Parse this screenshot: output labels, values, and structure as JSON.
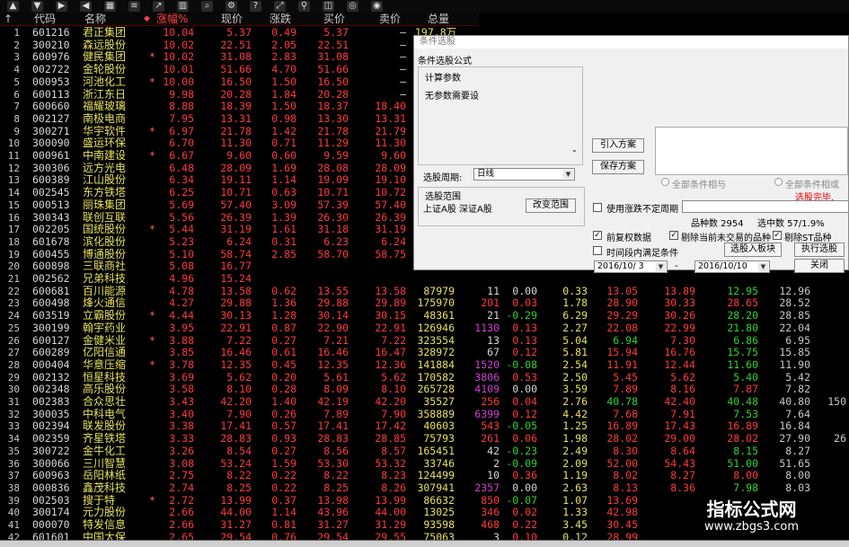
{
  "toolbar_icons": [
    "arrow-up-icon",
    "arrow-down-icon",
    "arrow-right-icon",
    "arrow-left-icon",
    "grid-icon",
    "list-icon",
    "chart-icon",
    "bars-icon",
    "search-icon",
    "settings-icon",
    "help-icon",
    "expand-icon",
    "filter-icon",
    "stack-icon",
    "radar-icon",
    "eye-icon"
  ],
  "columns": {
    "code": "代码",
    "name": "名称",
    "pct": "涨幅%",
    "price": "现价",
    "chg": "涨跌",
    "bid": "买价",
    "ask": "卖价",
    "vol": "总量"
  },
  "rows": [
    {
      "idx": "1",
      "code": "601216",
      "name": "君正集团",
      "pct": "10.04",
      "price": "5.37",
      "chg": "0.49",
      "bid": "5.37",
      "ask": "—",
      "vol": "197.8万",
      "mark": "",
      "c": "r"
    },
    {
      "idx": "2",
      "code": "300210",
      "name": "森远股份",
      "pct": "10.02",
      "price": "22.51",
      "chg": "2.05",
      "bid": "22.51",
      "ask": "—",
      "mark": "",
      "c": "r"
    },
    {
      "idx": "3",
      "code": "600976",
      "name": "健民集团",
      "pct": "10.02",
      "price": "31.08",
      "chg": "2.83",
      "bid": "31.08",
      "ask": "—",
      "mark": "*",
      "c": "r"
    },
    {
      "idx": "4",
      "code": "002722",
      "name": "金轮股份",
      "pct": "10.01",
      "price": "51.66",
      "chg": "4.70",
      "bid": "51.66",
      "ask": "—",
      "mark": "",
      "c": "r"
    },
    {
      "idx": "5",
      "code": "000953",
      "name": "河池化工",
      "pct": "10.00",
      "price": "16.50",
      "chg": "1.50",
      "bid": "16.50",
      "ask": "—",
      "mark": "*",
      "c": "r"
    },
    {
      "idx": "6",
      "code": "600113",
      "name": "浙江东日",
      "pct": "9.98",
      "price": "20.28",
      "chg": "1.84",
      "bid": "20.28",
      "ask": "—",
      "mark": "",
      "c": "r"
    },
    {
      "idx": "7",
      "code": "600660",
      "name": "福耀玻璃",
      "pct": "8.88",
      "price": "18.39",
      "chg": "1.50",
      "bid": "18.37",
      "ask": "18.40",
      "mark": "",
      "c": "r"
    },
    {
      "idx": "8",
      "code": "002127",
      "name": "南极电商",
      "pct": "7.95",
      "price": "13.31",
      "chg": "0.98",
      "bid": "13.30",
      "ask": "13.31",
      "mark": "",
      "c": "r"
    },
    {
      "idx": "9",
      "code": "300271",
      "name": "华宇软件",
      "pct": "6.97",
      "price": "21.78",
      "chg": "1.42",
      "bid": "21.78",
      "ask": "21.79",
      "mark": "*",
      "c": "r"
    },
    {
      "idx": "10",
      "code": "300090",
      "name": "盛运环保",
      "pct": "6.70",
      "price": "11.30",
      "chg": "0.71",
      "bid": "11.29",
      "ask": "11.30",
      "mark": "",
      "c": "r"
    },
    {
      "idx": "11",
      "code": "000961",
      "name": "中南建设",
      "pct": "6.67",
      "price": "9.60",
      "chg": "0.60",
      "bid": "9.59",
      "ask": "9.60",
      "mark": "*",
      "c": "r"
    },
    {
      "idx": "12",
      "code": "300306",
      "name": "远方光电",
      "pct": "6.48",
      "price": "28.09",
      "chg": "1.69",
      "bid": "28.08",
      "ask": "28.09",
      "mark": "",
      "c": "r"
    },
    {
      "idx": "13",
      "code": "600389",
      "name": "江山股份",
      "pct": "6.34",
      "price": "19.11",
      "chg": "1.14",
      "bid": "19.09",
      "ask": "19.10",
      "mark": "",
      "c": "r"
    },
    {
      "idx": "14",
      "code": "002545",
      "name": "东方铁塔",
      "pct": "6.25",
      "price": "10.71",
      "chg": "0.63",
      "bid": "10.71",
      "ask": "10.72",
      "mark": "",
      "c": "r"
    },
    {
      "idx": "15",
      "code": "000513",
      "name": "丽珠集团",
      "pct": "5.69",
      "price": "57.40",
      "chg": "3.09",
      "bid": "57.39",
      "ask": "57.40",
      "mark": "",
      "c": "r"
    },
    {
      "idx": "16",
      "code": "300343",
      "name": "联创互联",
      "pct": "5.56",
      "price": "26.39",
      "chg": "1.39",
      "bid": "26.30",
      "ask": "26.39",
      "mark": "",
      "c": "r"
    },
    {
      "idx": "17",
      "code": "002205",
      "name": "国统股份",
      "pct": "5.44",
      "price": "31.19",
      "chg": "1.61",
      "bid": "31.18",
      "ask": "31.19",
      "mark": "*",
      "c": "r"
    },
    {
      "idx": "18",
      "code": "601678",
      "name": "滨化股份",
      "pct": "5.23",
      "price": "6.24",
      "chg": "0.31",
      "bid": "6.23",
      "ask": "6.24",
      "mark": "",
      "c": "r"
    },
    {
      "idx": "19",
      "code": "600455",
      "name": "博通股份",
      "pct": "5.10",
      "price": "58.74",
      "chg": "2.85",
      "bid": "58.70",
      "ask": "58.75",
      "mark": "",
      "c": "r"
    },
    {
      "idx": "20",
      "code": "600898",
      "name": "三联商社",
      "pct": "5.08",
      "price": "16.77",
      "chg": "",
      "bid": "",
      "ask": "",
      "mark": "",
      "c": "r"
    },
    {
      "idx": "21",
      "code": "002562",
      "name": "兄弟科技",
      "pct": "4.96",
      "price": "15.24",
      "chg": "",
      "bid": "",
      "ask": "",
      "mark": "",
      "c": "r"
    },
    {
      "idx": "22",
      "code": "600681",
      "name": "百川能源",
      "pct": "4.78",
      "price": "13.58",
      "chg": "0.62",
      "bid": "13.55",
      "ask": "13.58",
      "vol": "87979",
      "cur": "11",
      "spd": "0.00",
      "trn": "0.33",
      "open": "13.05",
      "high": "13.89",
      "low": "12.95",
      "close": "12.96",
      "mark": "",
      "c": "r"
    },
    {
      "idx": "23",
      "code": "600498",
      "name": "烽火通信",
      "pct": "4.27",
      "price": "29.88",
      "chg": "1.36",
      "bid": "29.88",
      "ask": "29.89",
      "vol": "175970",
      "cur": "201",
      "spd": "0.03",
      "trn": "1.78",
      "open": "28.90",
      "high": "30.33",
      "low": "28.65",
      "close": "28.52",
      "mark": "",
      "c": "r"
    },
    {
      "idx": "24",
      "code": "603519",
      "name": "立霸股份",
      "pct": "4.44",
      "price": "30.13",
      "chg": "1.28",
      "bid": "30.14",
      "ask": "30.15",
      "vol": "48361",
      "cur": "21",
      "spd": "-0.29",
      "trn": "6.29",
      "open": "29.29",
      "high": "30.26",
      "low": "28.20",
      "close": "28.85",
      "mark": "*",
      "c": "r"
    },
    {
      "idx": "25",
      "code": "300199",
      "name": "翰宇药业",
      "pct": "3.95",
      "price": "22.91",
      "chg": "0.87",
      "bid": "22.90",
      "ask": "22.91",
      "vol": "126946",
      "cur": "1130",
      "spd": "0.13",
      "trn": "2.27",
      "open": "22.08",
      "high": "22.99",
      "low": "21.80",
      "close": "22.04",
      "mark": "",
      "c": "r"
    },
    {
      "idx": "26",
      "code": "600127",
      "name": "金健米业",
      "pct": "3.88",
      "price": "7.22",
      "chg": "0.27",
      "bid": "7.21",
      "ask": "7.22",
      "vol": "323554",
      "cur": "13",
      "spd": "0.13",
      "trn": "5.04",
      "open": "6.94",
      "high": "7.30",
      "low": "6.86",
      "close": "6.95",
      "mark": "*",
      "c": "r"
    },
    {
      "idx": "27",
      "code": "600289",
      "name": "亿阳信通",
      "pct": "3.85",
      "price": "16.46",
      "chg": "0.61",
      "bid": "16.46",
      "ask": "16.47",
      "vol": "328972",
      "cur": "67",
      "spd": "0.12",
      "trn": "5.81",
      "open": "15.94",
      "high": "16.76",
      "low": "15.75",
      "close": "15.85",
      "mark": "",
      "c": "r"
    },
    {
      "idx": "28",
      "code": "000404",
      "name": "华意压缩",
      "pct": "3.78",
      "price": "12.35",
      "chg": "0.45",
      "bid": "12.35",
      "ask": "12.36",
      "vol": "141884",
      "cur": "1520",
      "spd": "-0.08",
      "trn": "2.54",
      "open": "11.91",
      "high": "12.44",
      "low": "11.60",
      "close": "11.90",
      "mark": "*",
      "c": "r"
    },
    {
      "idx": "29",
      "code": "002132",
      "name": "恒星科技",
      "pct": "3.69",
      "price": "5.62",
      "chg": "0.20",
      "bid": "5.61",
      "ask": "5.62",
      "vol": "170582",
      "cur": "3806",
      "spd": "0.53",
      "trn": "2.50",
      "open": "5.45",
      "high": "5.62",
      "low": "5.40",
      "close": "5.42",
      "mark": "",
      "c": "r"
    },
    {
      "idx": "30",
      "code": "002348",
      "name": "高乐股份",
      "pct": "3.58",
      "price": "8.10",
      "chg": "0.28",
      "bid": "8.09",
      "ask": "8.10",
      "vol": "265728",
      "cur": "4109",
      "spd": "0.00",
      "trn": "3.59",
      "open": "7.89",
      "high": "8.16",
      "low": "7.87",
      "close": "7.82",
      "mark": "",
      "c": "r"
    },
    {
      "idx": "31",
      "code": "002383",
      "name": "合众思壮",
      "pct": "3.43",
      "price": "42.20",
      "chg": "1.40",
      "bid": "42.19",
      "ask": "42.20",
      "vol": "35527",
      "cur": "256",
      "spd": "0.04",
      "trn": "2.76",
      "open": "40.78",
      "high": "42.40",
      "low": "40.48",
      "close": "40.80",
      "amt": "150",
      "mark": "",
      "c": "r"
    },
    {
      "idx": "32",
      "code": "300035",
      "name": "中科电气",
      "pct": "3.40",
      "price": "7.90",
      "chg": "0.26",
      "bid": "7.89",
      "ask": "7.90",
      "vol": "358889",
      "cur": "6399",
      "spd": "0.12",
      "trn": "4.42",
      "open": "7.68",
      "high": "7.91",
      "low": "7.53",
      "close": "7.64",
      "mark": "",
      "c": "r"
    },
    {
      "idx": "33",
      "code": "002394",
      "name": "联发股份",
      "pct": "3.38",
      "price": "17.41",
      "chg": "0.57",
      "bid": "17.41",
      "ask": "17.42",
      "vol": "40603",
      "cur": "543",
      "spd": "-0.05",
      "trn": "1.25",
      "open": "16.89",
      "high": "17.43",
      "low": "16.89",
      "close": "16.84",
      "mark": "",
      "c": "r"
    },
    {
      "idx": "34",
      "code": "002359",
      "name": "齐星铁塔",
      "pct": "3.33",
      "price": "28.83",
      "chg": "0.93",
      "bid": "28.83",
      "ask": "28.85",
      "vol": "75793",
      "cur": "261",
      "spd": "0.06",
      "trn": "1.98",
      "open": "28.02",
      "high": "29.00",
      "low": "28.02",
      "close": "27.90",
      "amt": "26",
      "mark": "",
      "c": "r"
    },
    {
      "idx": "35",
      "code": "300722",
      "name": "金牛化工",
      "pct": "3.26",
      "price": "8.54",
      "chg": "0.27",
      "bid": "8.56",
      "ask": "8.57",
      "vol": "165451",
      "cur": "42",
      "spd": "-0.23",
      "trn": "2.49",
      "open": "8.30",
      "high": "8.64",
      "low": "8.15",
      "close": "8.27",
      "mark": "",
      "c": "r"
    },
    {
      "idx": "36",
      "code": "300066",
      "name": "三川智慧",
      "pct": "3.08",
      "price": "53.24",
      "chg": "1.59",
      "bid": "53.30",
      "ask": "53.32",
      "vol": "33746",
      "cur": "2",
      "spd": "-0.09",
      "trn": "2.09",
      "open": "52.00",
      "high": "54.43",
      "low": "51.00",
      "close": "51.65",
      "mark": "",
      "c": "r"
    },
    {
      "idx": "37",
      "code": "600963",
      "name": "岳阳林纸",
      "pct": "2.75",
      "price": "8.22",
      "chg": "0.22",
      "bid": "8.22",
      "ask": "8.23",
      "vol": "124499",
      "cur": "10",
      "spd": "0.36",
      "trn": "1.19",
      "open": "8.02",
      "high": "8.27",
      "low": "8.00",
      "close": "8.00",
      "mark": "",
      "c": "r"
    },
    {
      "idx": "38",
      "code": "000836",
      "name": "鑫茂科技",
      "pct": "2.74",
      "price": "8.25",
      "chg": "0.22",
      "bid": "8.25",
      "ask": "8.26",
      "vol": "307941",
      "cur": "2357",
      "spd": "0.00",
      "trn": "2.63",
      "open": "8.13",
      "high": "8.36",
      "low": "7.98",
      "close": "8.03",
      "mark": "",
      "c": "r"
    },
    {
      "idx": "39",
      "code": "002503",
      "name": "搜于特",
      "pct": "2.72",
      "price": "13.99",
      "chg": "0.37",
      "bid": "13.98",
      "ask": "13.99",
      "vol": "86632",
      "cur": "850",
      "spd": "-0.07",
      "trn": "1.07",
      "open": "13.69",
      "high": "",
      "low": "",
      "close": "",
      "mark": "*",
      "c": "r"
    },
    {
      "idx": "40",
      "code": "300174",
      "name": "元力股份",
      "pct": "2.66",
      "price": "44.00",
      "chg": "1.14",
      "bid": "43.96",
      "ask": "44.00",
      "vol": "13025",
      "cur": "346",
      "spd": "0.02",
      "trn": "1.33",
      "open": "42.98",
      "high": "",
      "low": "",
      "close": "",
      "mark": "",
      "c": "r"
    },
    {
      "idx": "41",
      "code": "000070",
      "name": "特发信息",
      "pct": "2.66",
      "price": "31.27",
      "chg": "0.81",
      "bid": "31.27",
      "ask": "31.29",
      "vol": "93598",
      "cur": "468",
      "spd": "0.22",
      "trn": "3.45",
      "open": "30.45",
      "high": "",
      "low": "",
      "close": "",
      "mark": "",
      "c": "r"
    },
    {
      "idx": "42",
      "code": "601601",
      "name": "中国太保",
      "pct": "2.65",
      "price": "29.54",
      "chg": "0.76",
      "bid": "29.54",
      "ask": "29.55",
      "vol": "75063",
      "cur": "3",
      "spd": "0.10",
      "trn": "0.12",
      "open": "28.99",
      "high": "",
      "low": "",
      "close": "",
      "mark": "",
      "c": "r"
    }
  ],
  "dialog": {
    "title": "条件选股",
    "formula_label": "条件选股公式",
    "params_group": "计算参数",
    "params_text": "无参数需要设",
    "btn_add": "引入方案",
    "btn_save": "保存方案",
    "period_label": "选股周期:",
    "period_value": "日线",
    "range_group": "选股范围",
    "range_text": "上证A股 深证A股",
    "btn_change_range": "改变范围",
    "radio_all_and": "全部条件相与",
    "radio_all_or": "全部条件相或",
    "status": "选股完毕.",
    "use_range_label": "使用涨跌不定周期",
    "count_label": "品种数 2954",
    "selected_label": "选中数 57/1.9%",
    "chk_prefq": "前复权数据",
    "chk_excl_untraded": "剔除当前未交易的品种",
    "chk_excl_st": "剔除ST品种",
    "chk_timerange": "时间段内满足条件",
    "date_from": "2016/10/ 3",
    "date_to": "2016/10/10",
    "btn_to_block": "选股入板块",
    "btn_execute": "执行选股",
    "btn_close": "关闭"
  },
  "watermark": {
    "title": "指标公式网",
    "url": "www.zbgs3.com"
  },
  "colors": {
    "up": "#ff3a3a",
    "down": "#2ed42e",
    "name": "#e8e060",
    "bg": "#000000"
  }
}
